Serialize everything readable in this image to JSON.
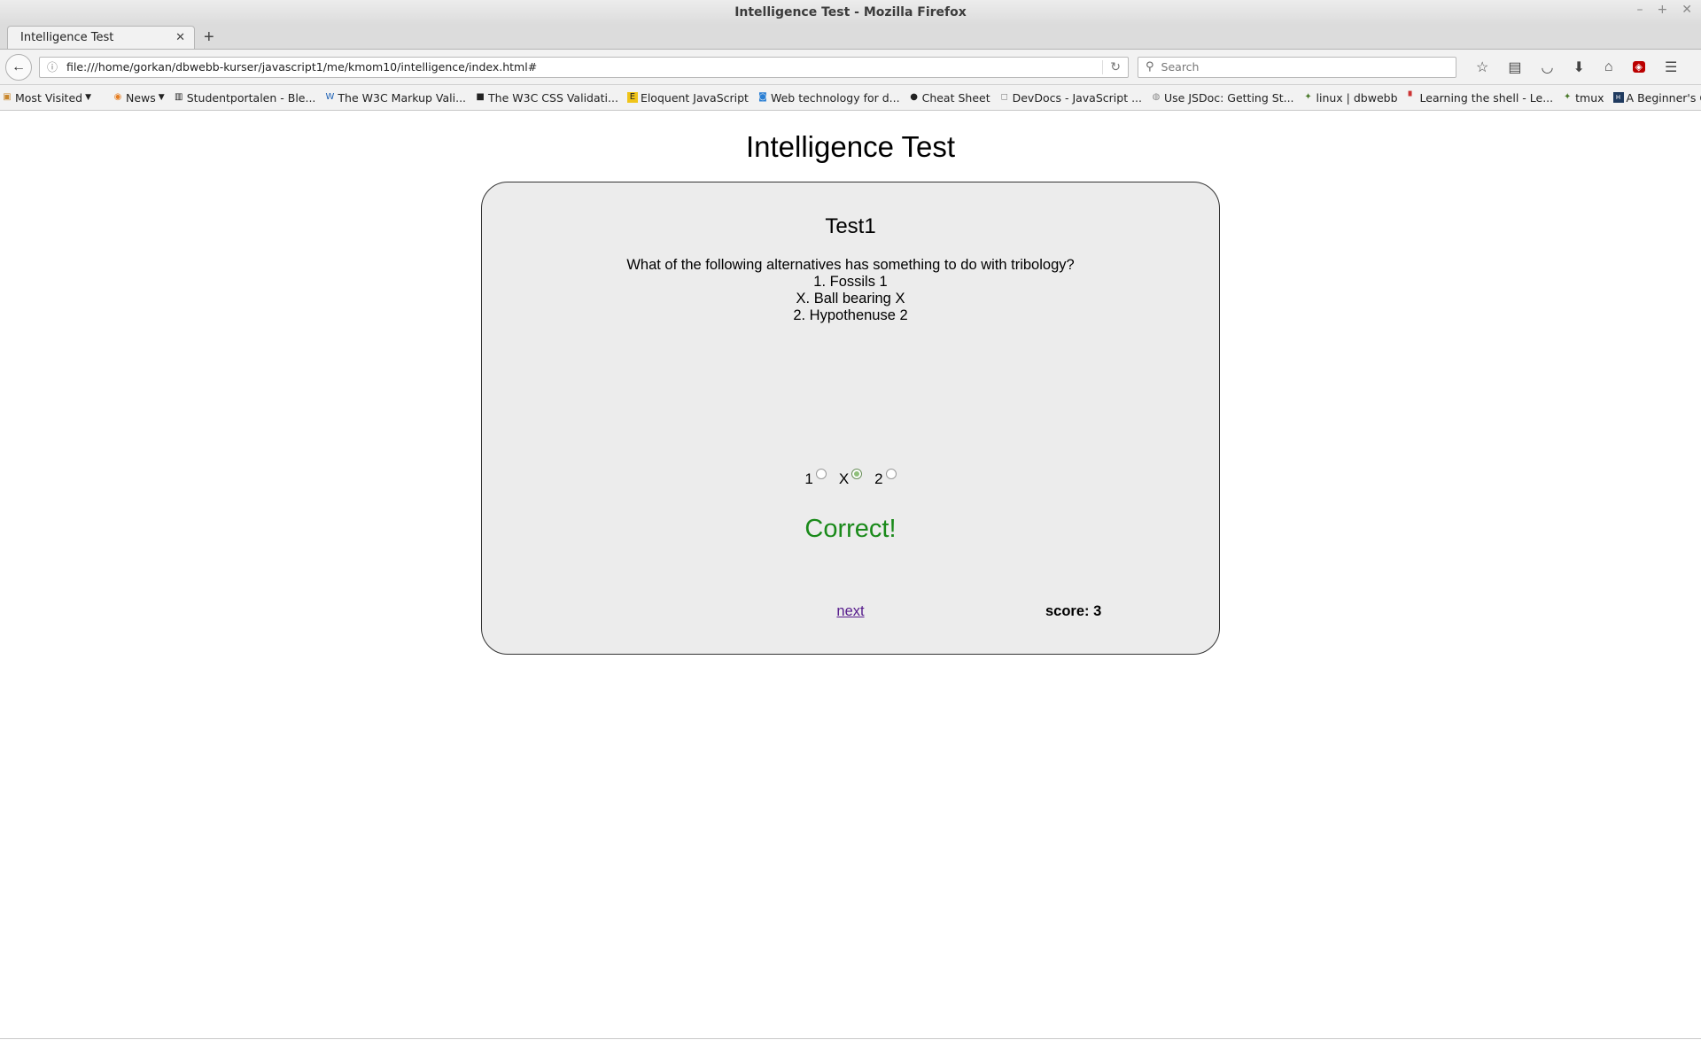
{
  "window": {
    "title": "Intelligence Test - Mozilla Firefox"
  },
  "tab": {
    "label": "Intelligence Test"
  },
  "navbar": {
    "url": "file:///home/gorkan/dbwebb-kurser/javascript1/me/kmom10/intelligence/index.html#",
    "search_placeholder": "Search"
  },
  "bookmarks": [
    {
      "label": "Most Visited",
      "icon": "folder-icon"
    },
    {
      "label": "News",
      "icon": "rss-icon"
    },
    {
      "label": "Studentportalen - Ble...",
      "icon": "bth-icon"
    },
    {
      "label": "The W3C Markup Vali...",
      "icon": "w3c-icon"
    },
    {
      "label": "The W3C CSS Validati...",
      "icon": "css-icon"
    },
    {
      "label": "Eloquent JavaScript",
      "icon": "ejs-icon"
    },
    {
      "label": "Web technology for d...",
      "icon": "mdn-icon"
    },
    {
      "label": "Cheat Sheet",
      "icon": "cheatsheet-icon"
    },
    {
      "label": "DevDocs - JavaScript ...",
      "icon": "devdocs-icon"
    },
    {
      "label": "Use JSDoc: Getting St...",
      "icon": "jsdoc-icon"
    },
    {
      "label": "linux | dbwebb",
      "icon": "dbwebb-icon"
    },
    {
      "label": "Learning the shell - Le...",
      "icon": "shell-icon"
    },
    {
      "label": "tmux",
      "icon": "dbwebb-icon"
    },
    {
      "label": "A Beginner's Guide to...",
      "icon": "htg-icon"
    }
  ],
  "page": {
    "title": "Intelligence Test",
    "test_title": "Test1",
    "question": "What of the following alternatives has something to do with tribology?",
    "alternatives": [
      "1. Fossils 1",
      "X. Ball bearing X",
      "2. Hypothenuse 2"
    ],
    "options": [
      {
        "label": "1",
        "checked": false
      },
      {
        "label": "X",
        "checked": true
      },
      {
        "label": "2",
        "checked": false
      }
    ],
    "result": "Correct!",
    "next_label": "next",
    "score_label": "score: 3",
    "colors": {
      "result": "#1a8a1a",
      "link": "#551a8b"
    }
  }
}
